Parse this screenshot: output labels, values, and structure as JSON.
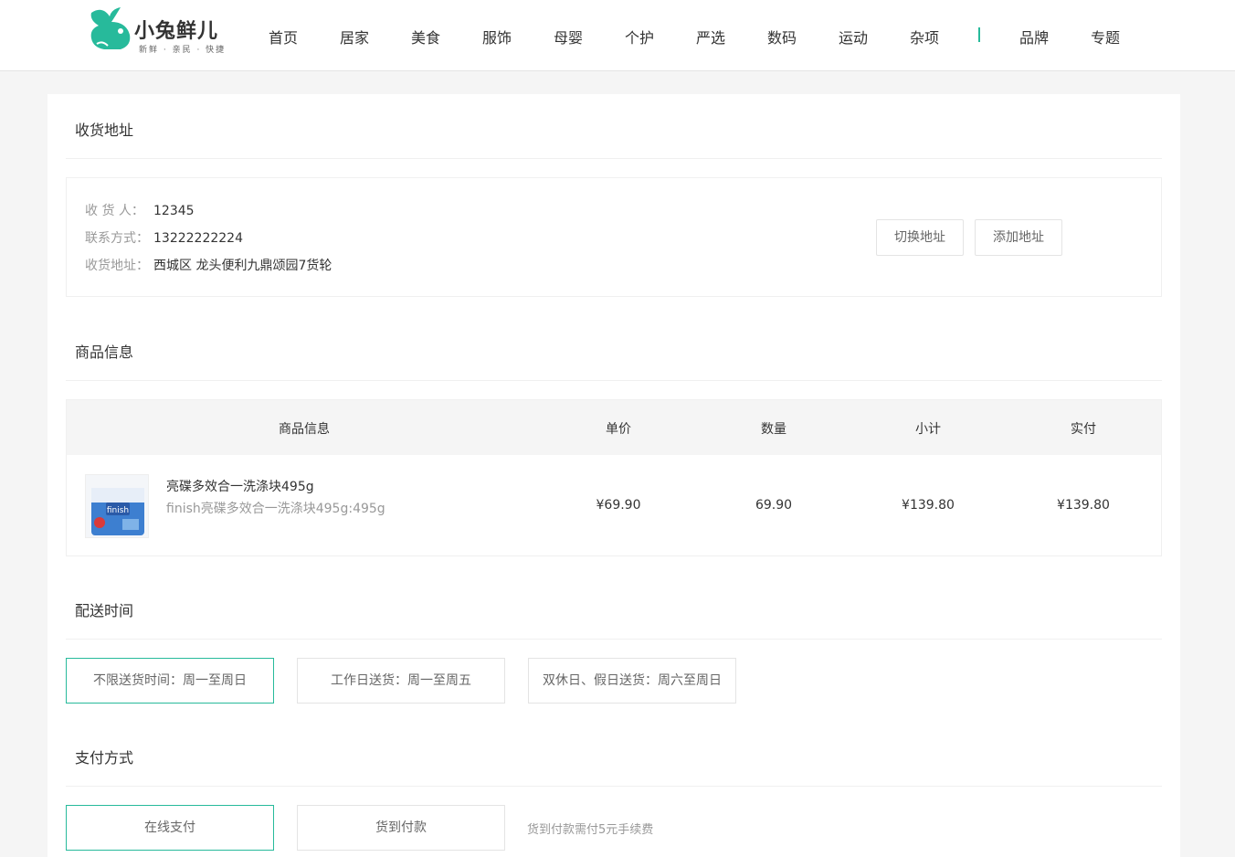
{
  "header": {
    "logo_title": "小兔鲜儿",
    "logo_subtitle": "新鲜 · 亲民 · 快捷",
    "nav": [
      "首页",
      "居家",
      "美食",
      "服饰",
      "母婴",
      "个护",
      "严选",
      "数码",
      "运动",
      "杂项"
    ],
    "nav_extra": [
      "品牌",
      "专题"
    ]
  },
  "address": {
    "title": "收货地址",
    "receiver_label": "收 货 人：",
    "receiver": "12345",
    "phone_label": "联系方式：",
    "phone": "13222222224",
    "addr_label": "收货地址：",
    "addr": "西城区 龙头便利九鼎颂园7货轮",
    "switch_btn": "切换地址",
    "add_btn": "添加地址"
  },
  "goods": {
    "title": "商品信息",
    "headers": [
      "商品信息",
      "单价",
      "数量",
      "小计",
      "实付"
    ],
    "item": {
      "name": "亮碟多效合一洗涤块495g",
      "spec": "finish亮碟多效合一洗涤块495g:495g",
      "price": "¥69.90",
      "count": "69.90",
      "subtotal": "¥139.80",
      "paid": "¥139.80",
      "image_label": "finish"
    }
  },
  "delivery": {
    "title": "配送时间",
    "options": [
      "不限送货时间：周一至周日",
      "工作日送货：周一至周五",
      "双休日、假日送货：周六至周日"
    ]
  },
  "payment": {
    "title": "支付方式",
    "options": [
      "在线支付",
      "货到付款"
    ],
    "tip": "货到付款需付5元手续费"
  },
  "colors": {
    "accent": "#27ba9b"
  }
}
